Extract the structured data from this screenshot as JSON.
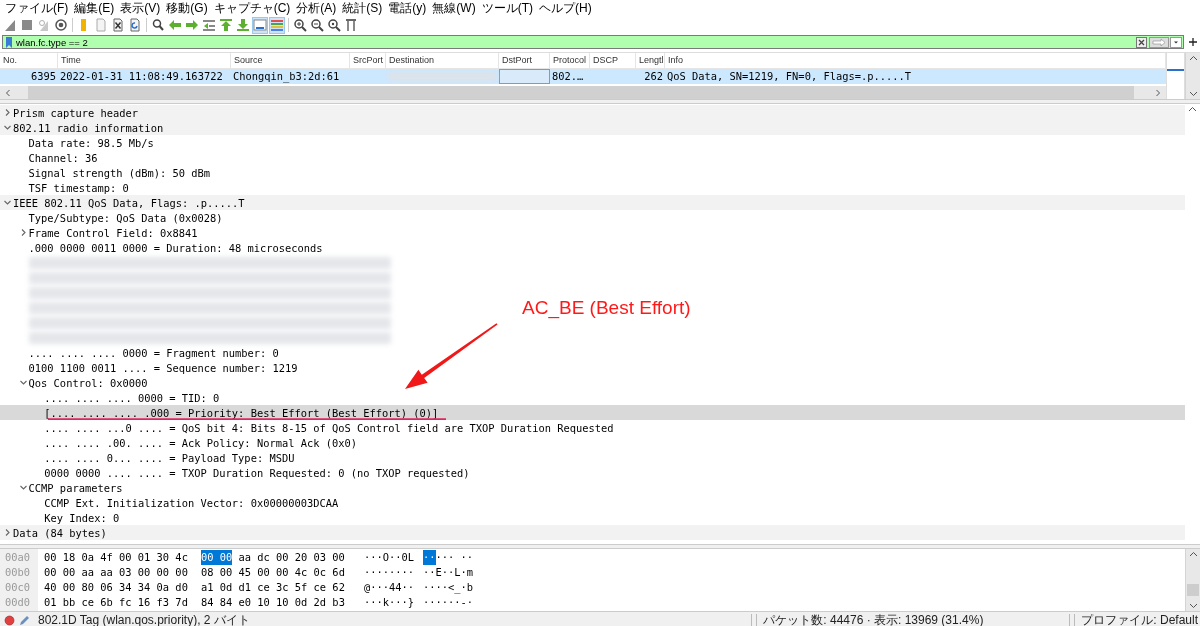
{
  "menu": [
    "ファイル(F)",
    "編集(E)",
    "表示(V)",
    "移動(G)",
    "キャプチャ(C)",
    "分析(A)",
    "統計(S)",
    "電話(y)",
    "無線(W)",
    "ツール(T)",
    "ヘルプ(H)"
  ],
  "toolbar_groups": [
    {
      "buttons": [
        {
          "kind": "fin",
          "on": false
        },
        {
          "kind": "stop",
          "on": false
        },
        {
          "kind": "restart",
          "on": false
        },
        {
          "kind": "options",
          "on": false
        }
      ]
    },
    {
      "buttons": [
        {
          "kind": "open",
          "on": false
        },
        {
          "kind": "file",
          "on": false
        },
        {
          "kind": "close",
          "on": false
        },
        {
          "kind": "reload",
          "on": false
        }
      ]
    },
    {
      "buttons": [
        {
          "kind": "find",
          "on": false
        },
        {
          "kind": "back",
          "on": false
        },
        {
          "kind": "forward",
          "on": false
        },
        {
          "kind": "goto",
          "on": false
        },
        {
          "kind": "first",
          "on": false
        },
        {
          "kind": "last",
          "on": false
        },
        {
          "kind": "autoscroll",
          "on": true
        },
        {
          "kind": "colorize",
          "on": true
        }
      ]
    },
    {
      "buttons": [
        {
          "kind": "zoomin",
          "on": false
        },
        {
          "kind": "zoomout",
          "on": false
        },
        {
          "kind": "zoomreset",
          "on": false
        },
        {
          "kind": "resize",
          "on": false
        }
      ]
    }
  ],
  "filter": {
    "value": "wlan.fc.type == 2",
    "valid": true
  },
  "packet_list": {
    "columns": [
      "No.",
      "Time",
      "Source",
      "SrcPort",
      "Destination",
      "DstPort",
      "Protocol",
      "DSCP",
      "Lengtl",
      "Info"
    ],
    "rows": [
      {
        "selected": true,
        "cells": [
          {
            "kind": "text",
            "text": "6395"
          },
          {
            "kind": "text",
            "text": "2022-01-31 11:08:49.163722"
          },
          {
            "kind": "text",
            "text": "Chongqin_b3:2d:61"
          },
          {
            "kind": "blank"
          },
          {
            "kind": "redacted"
          },
          {
            "kind": "focus"
          },
          {
            "kind": "text",
            "text": "802.…"
          },
          {
            "kind": "blank"
          },
          {
            "kind": "text",
            "text": "262"
          },
          {
            "kind": "text",
            "text": "QoS Data, SN=1219, FN=0, Flags=.p.....T"
          }
        ]
      }
    ]
  },
  "details": [
    {
      "kind": "field",
      "text": "Prism capture header",
      "expanded": false,
      "selected": false
    },
    {
      "kind": "field",
      "text": "802.11 radio information",
      "expanded": true,
      "selected": false,
      "children": [
        {
          "kind": "field",
          "text": "Data rate: 98.5 Mb/s",
          "selected": false
        },
        {
          "kind": "field",
          "text": "Channel: 36",
          "selected": false
        },
        {
          "kind": "field",
          "text": "Signal strength (dBm): 50 dBm",
          "selected": false
        },
        {
          "kind": "field",
          "text": "TSF timestamp: 0",
          "selected": false
        }
      ]
    },
    {
      "kind": "field",
      "text": "IEEE 802.11 QoS Data, Flags: .p.....T",
      "expanded": true,
      "selected": false,
      "children": [
        {
          "kind": "field",
          "text": "Type/Subtype: QoS Data (0x0028)",
          "selected": false
        },
        {
          "kind": "field",
          "text": "Frame Control Field: 0x8841",
          "expanded": false,
          "selected": false
        },
        {
          "kind": "field",
          "text": ".000 0000 0011 0000 = Duration: 48 microseconds",
          "selected": false
        },
        {
          "kind": "redacted",
          "selected": false
        },
        {
          "kind": "redacted",
          "selected": false
        },
        {
          "kind": "redacted",
          "selected": false
        },
        {
          "kind": "redacted",
          "selected": false
        },
        {
          "kind": "redacted",
          "selected": false
        },
        {
          "kind": "redacted",
          "selected": false
        },
        {
          "kind": "field",
          "text": ".... .... .... 0000 = Fragment number: 0",
          "selected": false
        },
        {
          "kind": "field",
          "text": "0100 1100 0011 .... = Sequence number: 1219",
          "selected": false
        },
        {
          "kind": "field",
          "text": "Qos Control: 0x0000",
          "expanded": true,
          "selected": false,
          "children": [
            {
              "kind": "field",
              "text": ".... .... .... 0000 = TID: 0",
              "selected": false
            },
            {
              "kind": "field",
              "text": "[.... .... .... .000 = Priority: Best Effort (Best Effort) (0)]",
              "selected": true
            },
            {
              "kind": "field",
              "text": ".... .... ...0 .... = QoS bit 4: Bits 8-15 of QoS Control field are TXOP Duration Requested",
              "selected": false
            },
            {
              "kind": "field",
              "text": ".... .... .00. .... = Ack Policy: Normal Ack (0x0)",
              "selected": false
            },
            {
              "kind": "field",
              "text": ".... .... 0... .... = Payload Type: MSDU",
              "selected": false
            },
            {
              "kind": "field",
              "text": "0000 0000 .... .... = TXOP Duration Requested: 0 (no TXOP requested)",
              "selected": false
            }
          ]
        },
        {
          "kind": "field",
          "text": "CCMP parameters",
          "expanded": true,
          "selected": false,
          "children": [
            {
              "kind": "field",
              "text": "CCMP Ext. Initialization Vector: 0x00000003DCAA",
              "selected": false
            },
            {
              "kind": "field",
              "text": "Key Index: 0",
              "selected": false
            }
          ]
        }
      ]
    },
    {
      "kind": "field",
      "text": "Data (84 bytes)",
      "expanded": false,
      "selected": false
    }
  ],
  "annotation": {
    "text": "AC_BE (Best Effort)"
  },
  "hex": [
    {
      "offset": "00a0",
      "hex_left": [
        {
          "text": "00 18 0a 4f 00 01 30 4c",
          "selected": false
        }
      ],
      "hex_right": [
        {
          "text": "00 00",
          "selected": true
        },
        {
          "text": "aa dc 00 20 03 00",
          "selected": false
        }
      ],
      "ascii_left": [
        {
          "text": "···O··0L",
          "selected": false
        }
      ],
      "ascii_right": [
        {
          "text": "··",
          "selected": true
        },
        {
          "text": "··· ··",
          "selected": false
        }
      ]
    },
    {
      "offset": "00b0",
      "hex_left": [
        {
          "text": "00 00 aa aa 03 00 00 00",
          "selected": false
        }
      ],
      "hex_right": [
        {
          "text": "08 00 45 00 00 4c 0c 6d",
          "selected": false
        }
      ],
      "ascii_left": [
        {
          "text": "········",
          "selected": false
        }
      ],
      "ascii_right": [
        {
          "text": "··E··L·m",
          "selected": false
        }
      ]
    },
    {
      "offset": "00c0",
      "hex_left": [
        {
          "text": "40 00 80 06 34 34 0a d0",
          "selected": false
        }
      ],
      "hex_right": [
        {
          "text": "a1 0d d1 ce 3c 5f ce 62",
          "selected": false
        }
      ],
      "ascii_left": [
        {
          "text": "@···44··",
          "selected": false
        }
      ],
      "ascii_right": [
        {
          "text": "····<_·b",
          "selected": false
        }
      ]
    },
    {
      "offset": "00d0",
      "hex_left": [
        {
          "text": "01 bb ce 6b fc 16 f3 7d",
          "selected": false
        }
      ],
      "hex_right": [
        {
          "text": "84 84 e0 10 10 0d 2d b3",
          "selected": false
        }
      ],
      "ascii_left": [
        {
          "text": "···k···}",
          "selected": false
        }
      ],
      "ascii_right": [
        {
          "text": "······-·",
          "selected": false
        }
      ]
    }
  ],
  "status_bar": {
    "field_info": "802.1D Tag (wlan.qos.priority), 2 バイト",
    "packets": "パケット数: 44476 · 表示: 13969 (31.4%)",
    "profile": "プロファイル: Default"
  }
}
